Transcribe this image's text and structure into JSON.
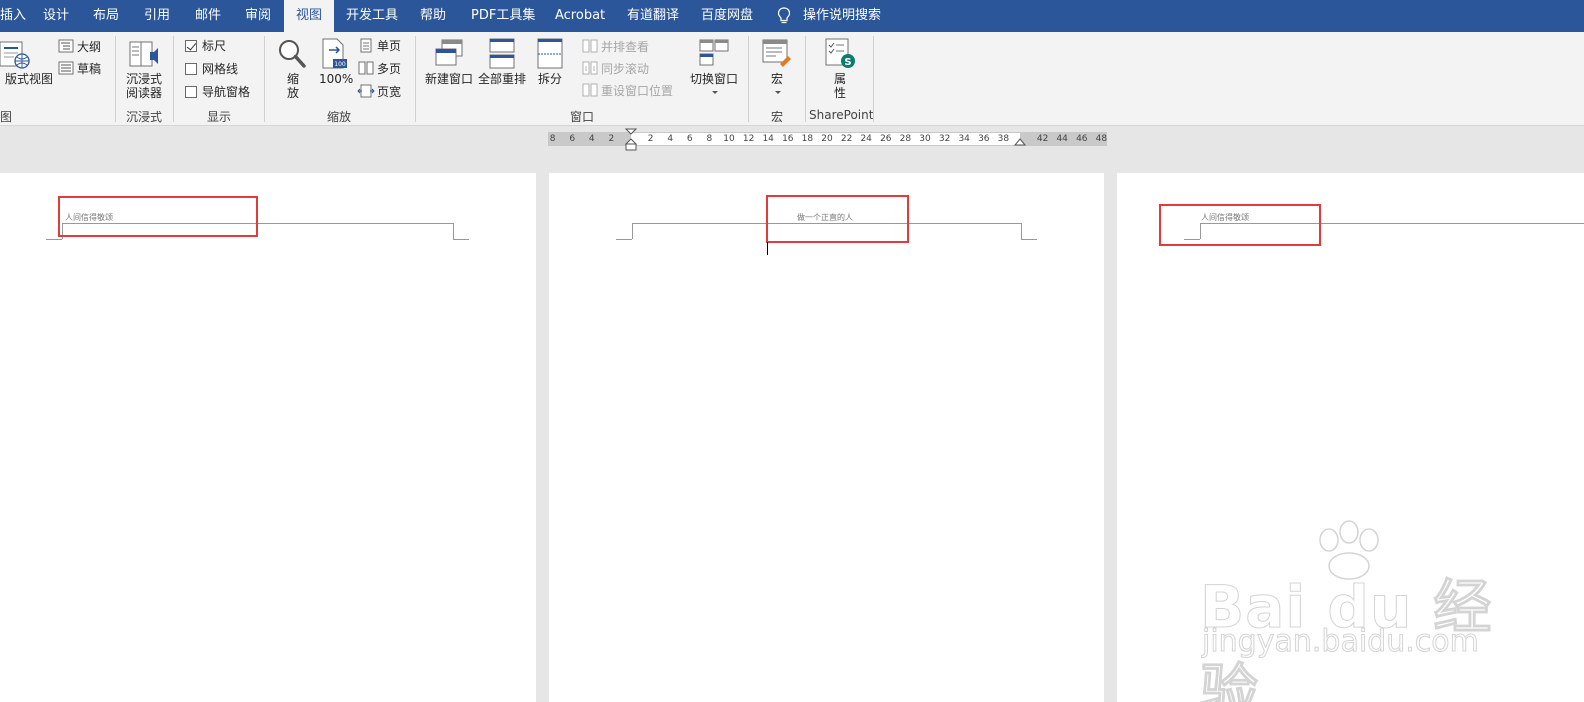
{
  "tabs": {
    "insert": "插入",
    "design": "设计",
    "layout": "布局",
    "references": "引用",
    "mailings": "邮件",
    "review": "审阅",
    "view": "视图",
    "developer": "开发工具",
    "help": "帮助",
    "pdf_tools": "PDF工具集",
    "acrobat": "Acrobat",
    "youdao": "有道翻译",
    "baidu_disk": "百度网盘",
    "tell_me": "操作说明搜索"
  },
  "ribbon": {
    "views": {
      "print_layout": "版式视图",
      "outline": "大纲",
      "draft": "草稿",
      "group_label": "图"
    },
    "immersive": {
      "reader": "沉浸式\n阅读器",
      "group_label": "沉浸式"
    },
    "show": {
      "ruler": "标尺",
      "ruler_checked": true,
      "gridlines": "网格线",
      "gridlines_checked": false,
      "nav_pane": "导航窗格",
      "nav_pane_checked": false,
      "group_label": "显示"
    },
    "zoom": {
      "zoom": "缩\n放",
      "hundred": "100%",
      "one_page": "单页",
      "multi_page": "多页",
      "page_width": "页宽",
      "group_label": "缩放"
    },
    "window": {
      "new_window": "新建窗口",
      "arrange_all": "全部重排",
      "split": "拆分",
      "side_by_side": "并排查看",
      "sync_scroll": "同步滚动",
      "reset_pos": "重设窗口位置",
      "switch_window": "切换窗口",
      "group_label": "窗口"
    },
    "macros": {
      "macros": "宏",
      "group_label": "宏"
    },
    "sharepoint": {
      "properties": "属\n性",
      "group_label": "SharePoint"
    }
  },
  "ruler": {
    "left_numbers": [
      "8",
      "6",
      "4",
      "2"
    ],
    "right_numbers": [
      "2",
      "4",
      "6",
      "8",
      "10",
      "12",
      "14",
      "16",
      "18",
      "20",
      "22",
      "24",
      "26",
      "28",
      "30",
      "32",
      "34",
      "36",
      "38"
    ],
    "margin_numbers": [
      "42",
      "44",
      "46",
      "48"
    ]
  },
  "pages": [
    {
      "header_text": "人间信得敬颂"
    },
    {
      "header_text": "做一个正直的人"
    },
    {
      "header_text": "人间信得敬颂"
    }
  ],
  "watermark": {
    "brand": "Bai du 经验",
    "url": "jingyan.baidu.com"
  },
  "colors": {
    "ribbon_blue": "#2b579a",
    "highlight_red": "#e23b3b"
  }
}
